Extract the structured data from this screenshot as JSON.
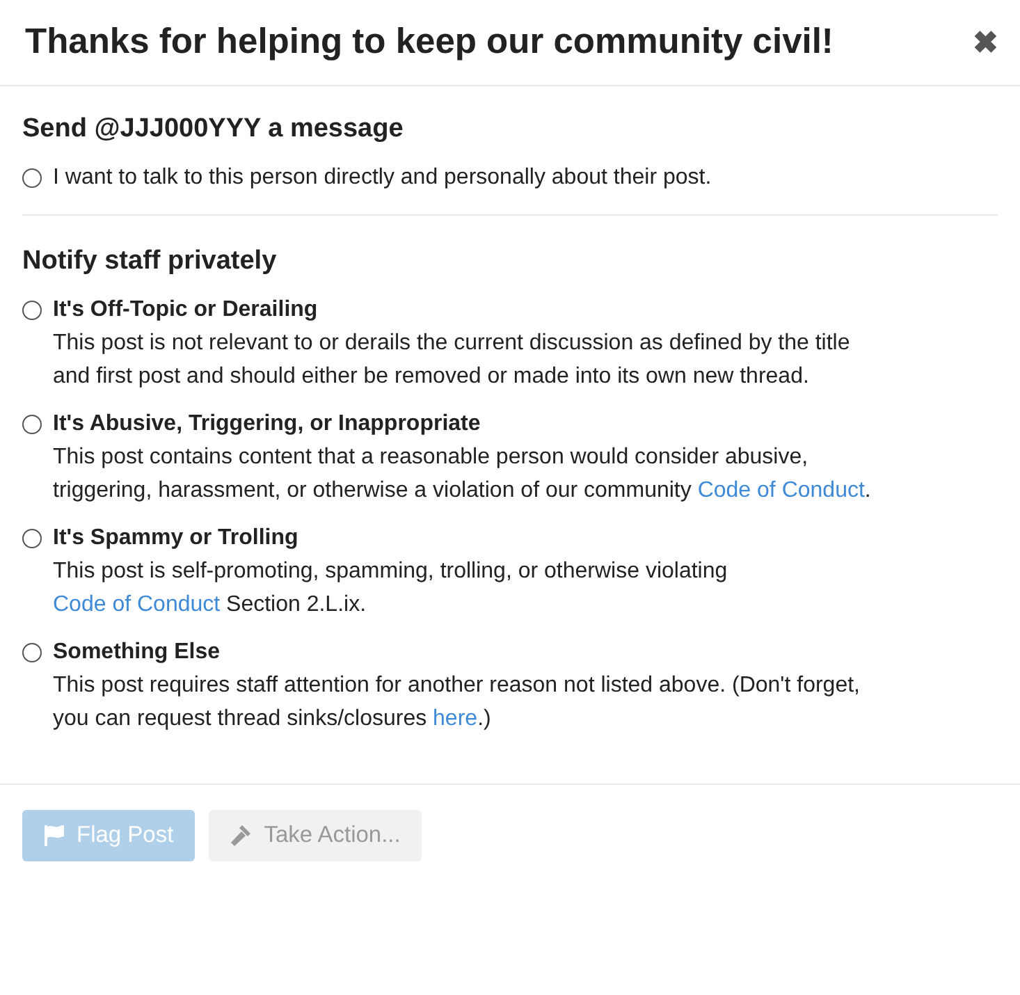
{
  "dialog": {
    "title": "Thanks for helping to keep our community civil!",
    "close": "✖"
  },
  "sections": [
    {
      "heading": "Send @JJJ000YYY a message",
      "options": [
        {
          "label": "I want to talk to this person directly and personally about their post.",
          "selected": false
        }
      ]
    },
    {
      "heading": "Notify staff privately",
      "options": [
        {
          "label": "It's Off-Topic or Derailing",
          "selected": false,
          "description": [
            {
              "text": "This post is not relevant to or derails the current discussion as defined by the title and first post and should either be removed or made into its own new thread.",
              "kind": "text"
            }
          ]
        },
        {
          "label": "It's Abusive, Triggering, or Inappropriate",
          "selected": false,
          "description": [
            {
              "text": "This post contains content that a reasonable person would consider abusive, triggering, harassment, or otherwise a violation of our community ",
              "kind": "text"
            },
            {
              "text": "Code of Conduct",
              "kind": "link"
            },
            {
              "text": ".",
              "kind": "text"
            }
          ]
        },
        {
          "label": "It's Spammy or Trolling",
          "selected": false,
          "description": [
            {
              "text": "This post is self-promoting, spamming, trolling, or otherwise violating ",
              "kind": "text"
            },
            {
              "text": "Code of Conduct",
              "kind": "link"
            },
            {
              "text": " Section 2.L.ix.",
              "kind": "text"
            }
          ]
        },
        {
          "label": "Something Else",
          "selected": false,
          "description": [
            {
              "text": "This post requires staff attention for another reason not listed above. (Don't forget, you can request thread sinks/closures ",
              "kind": "text"
            },
            {
              "text": "here",
              "kind": "link"
            },
            {
              "text": ".)",
              "kind": "text"
            }
          ]
        }
      ]
    }
  ],
  "buttons": [
    {
      "label": "Flag Post",
      "kind": "primary",
      "disabled": true
    },
    {
      "label": "Take Action...",
      "kind": "default",
      "disabled": true
    }
  ]
}
